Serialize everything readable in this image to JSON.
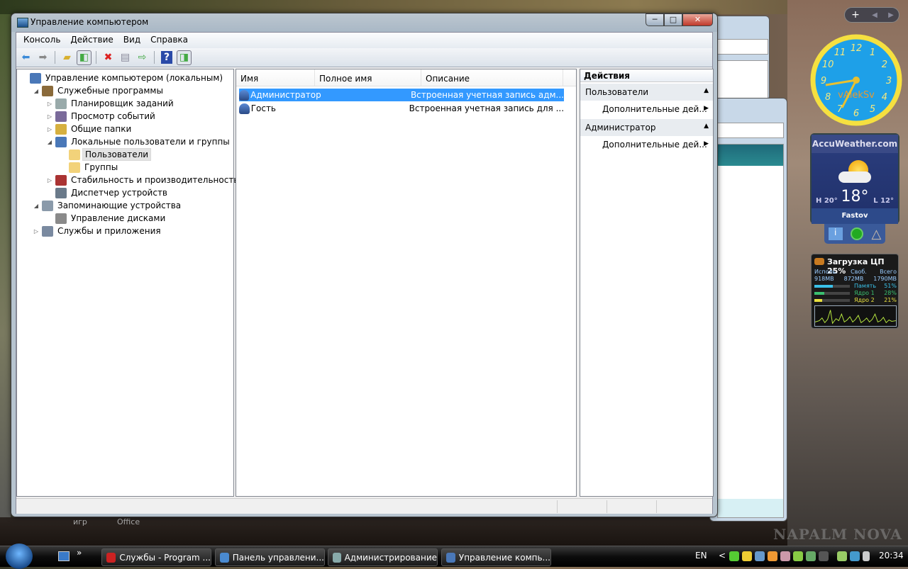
{
  "window": {
    "title": "Управление компьютером",
    "min": "─",
    "max": "□",
    "close": "✕"
  },
  "menu": [
    "Консоль",
    "Действие",
    "Вид",
    "Справка"
  ],
  "tree": [
    {
      "label": "Управление компьютером (локальным)",
      "level": 0,
      "exp": "",
      "color": "#4a78b8"
    },
    {
      "label": "Служебные программы",
      "level": 1,
      "exp": "◢",
      "color": "#8a6a3a"
    },
    {
      "label": "Планировщик заданий",
      "level": 2,
      "exp": "▷",
      "color": "#9aa"
    },
    {
      "label": "Просмотр событий",
      "level": 2,
      "exp": "▷",
      "color": "#7a6a9a"
    },
    {
      "label": "Общие папки",
      "level": 2,
      "exp": "▷",
      "color": "#d6b040"
    },
    {
      "label": "Локальные пользователи и группы",
      "level": 2,
      "exp": "◢",
      "color": "#4a78b8"
    },
    {
      "label": "Пользователи",
      "level": 3,
      "exp": "",
      "color": "#f2d27a",
      "selected": true
    },
    {
      "label": "Группы",
      "level": 3,
      "exp": "",
      "color": "#f2d27a"
    },
    {
      "label": "Стабильность и производительность",
      "level": 2,
      "exp": "▷",
      "color": "#a33"
    },
    {
      "label": "Диспетчер устройств",
      "level": 2,
      "exp": "",
      "color": "#6a7a8a"
    },
    {
      "label": "Запоминающие устройства",
      "level": 1,
      "exp": "◢",
      "color": "#8a9aaa"
    },
    {
      "label": "Управление дисками",
      "level": 2,
      "exp": "",
      "color": "#8a8a8a"
    },
    {
      "label": "Службы и приложения",
      "level": 1,
      "exp": "▷",
      "color": "#7a8aa0"
    }
  ],
  "list": {
    "columns": [
      "Имя",
      "Полное имя",
      "Описание"
    ],
    "rows": [
      {
        "name": "Администратор",
        "full": "",
        "desc": "Встроенная учетная запись адм...",
        "selected": true
      },
      {
        "name": "Гость",
        "full": "",
        "desc": "Встроенная учетная запись для ..."
      }
    ]
  },
  "actions": {
    "title": "Действия",
    "groups": [
      {
        "label": "Пользователи",
        "item": "Дополнительные дей..."
      },
      {
        "label": "Администратор",
        "item": "Дополнительные дей..."
      }
    ]
  },
  "clock": {
    "numbers": [
      "12",
      "1",
      "2",
      "3",
      "4",
      "5",
      "6",
      "7",
      "8",
      "9",
      "10",
      "11"
    ],
    "brand": "vAlekSv"
  },
  "weather": {
    "brand": "AccuWeather.com",
    "temp": "18°",
    "high": "H 20°",
    "low": "L 12°",
    "city": "Fastov"
  },
  "cpu": {
    "title": "Загрузка ЦП  25%",
    "headers": [
      "Исполь.",
      "Своб.",
      "Всего"
    ],
    "values": [
      "918MB",
      "872MB",
      "1790MB"
    ],
    "bars": [
      {
        "label": "Память",
        "value": "51%",
        "pct": 51,
        "color": "#3ac0e8"
      },
      {
        "label": "Ядро 1",
        "value": "28%",
        "pct": 28,
        "color": "#3ac070"
      },
      {
        "label": "Ядро 2",
        "value": "21%",
        "pct": 21,
        "color": "#e8e040"
      }
    ]
  },
  "desktop": {
    "labels": [
      "игр",
      "Office"
    ]
  },
  "taskbar": {
    "items": [
      {
        "label": "Службы - Program ...",
        "color": "#c22"
      },
      {
        "label": "Панель управлени...",
        "color": "#4a8ad0"
      },
      {
        "label": "Администрирование",
        "color": "#8aa"
      },
      {
        "label": "Управление компь...",
        "color": "#4a78b8"
      }
    ],
    "lang": "EN",
    "time": "20:34",
    "chevron": "»",
    "tray_more": "<"
  }
}
